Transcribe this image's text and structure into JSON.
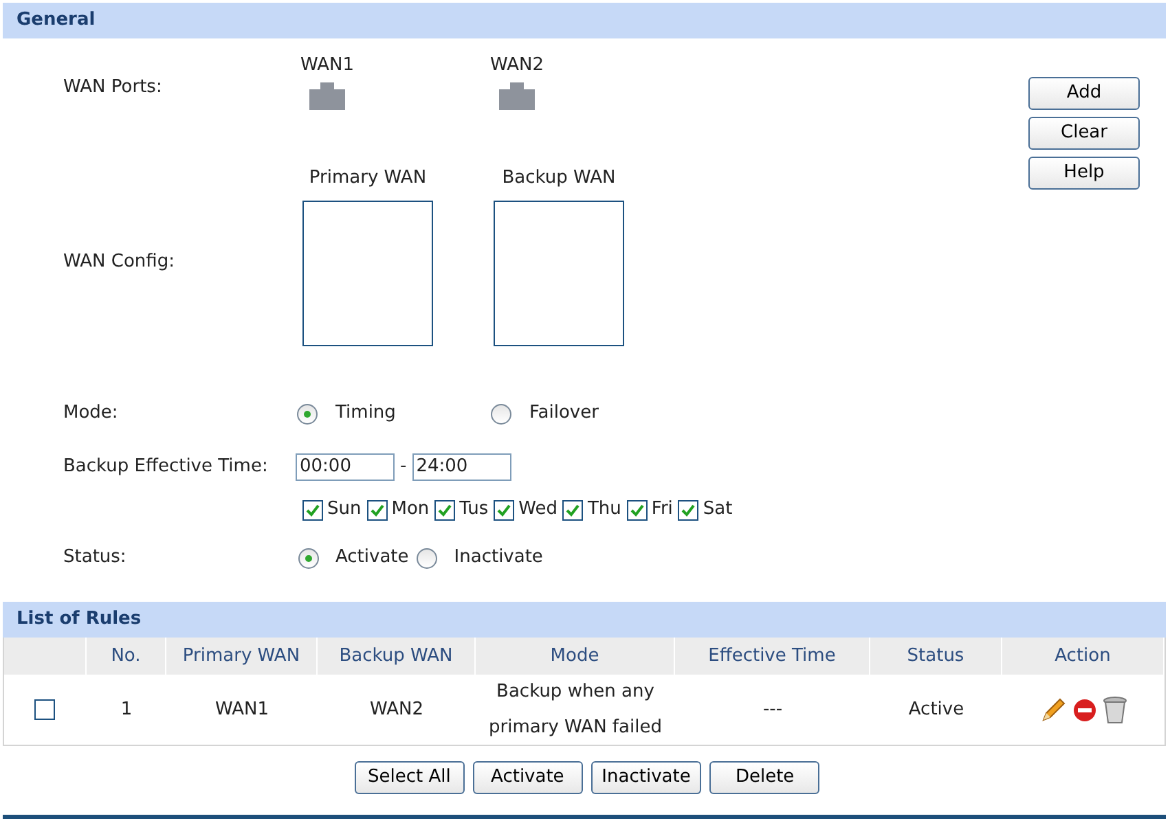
{
  "general": {
    "title": "General",
    "wan_ports": {
      "label": "WAN Ports:",
      "ports": [
        {
          "name": "WAN1"
        },
        {
          "name": "WAN2"
        }
      ]
    },
    "wan_config": {
      "label": "WAN Config:",
      "lists": [
        {
          "title": "Primary WAN"
        },
        {
          "title": "Backup WAN"
        }
      ]
    },
    "mode": {
      "label": "Mode:",
      "options": [
        {
          "label": "Timing",
          "selected": true
        },
        {
          "label": "Failover",
          "selected": false
        }
      ]
    },
    "backup_effective_time": {
      "label": "Backup Effective Time:",
      "start": "00:00",
      "separator": "-",
      "end": "24:00",
      "days": [
        {
          "label": "Sun",
          "checked": true
        },
        {
          "label": "Mon",
          "checked": true
        },
        {
          "label": "Tus",
          "checked": true
        },
        {
          "label": "Wed",
          "checked": true
        },
        {
          "label": "Thu",
          "checked": true
        },
        {
          "label": "Fri",
          "checked": true
        },
        {
          "label": "Sat",
          "checked": true
        }
      ]
    },
    "status": {
      "label": "Status:",
      "options": [
        {
          "label": "Activate",
          "selected": true
        },
        {
          "label": "Inactivate",
          "selected": false
        }
      ]
    },
    "buttons": [
      "Add",
      "Clear",
      "Help"
    ]
  },
  "list_of_rules": {
    "title": "List of Rules",
    "columns": [
      "No.",
      "Primary WAN",
      "Backup WAN",
      "Mode",
      "Effective Time",
      "Status",
      "Action"
    ],
    "rows": [
      {
        "checked": false,
        "no": "1",
        "primary_wan": "WAN1",
        "backup_wan": "WAN2",
        "mode": "Backup when any primary WAN failed",
        "effective_time": "---",
        "status": "Active"
      }
    ],
    "buttons": [
      "Select All",
      "Activate",
      "Inactivate",
      "Delete"
    ]
  }
}
